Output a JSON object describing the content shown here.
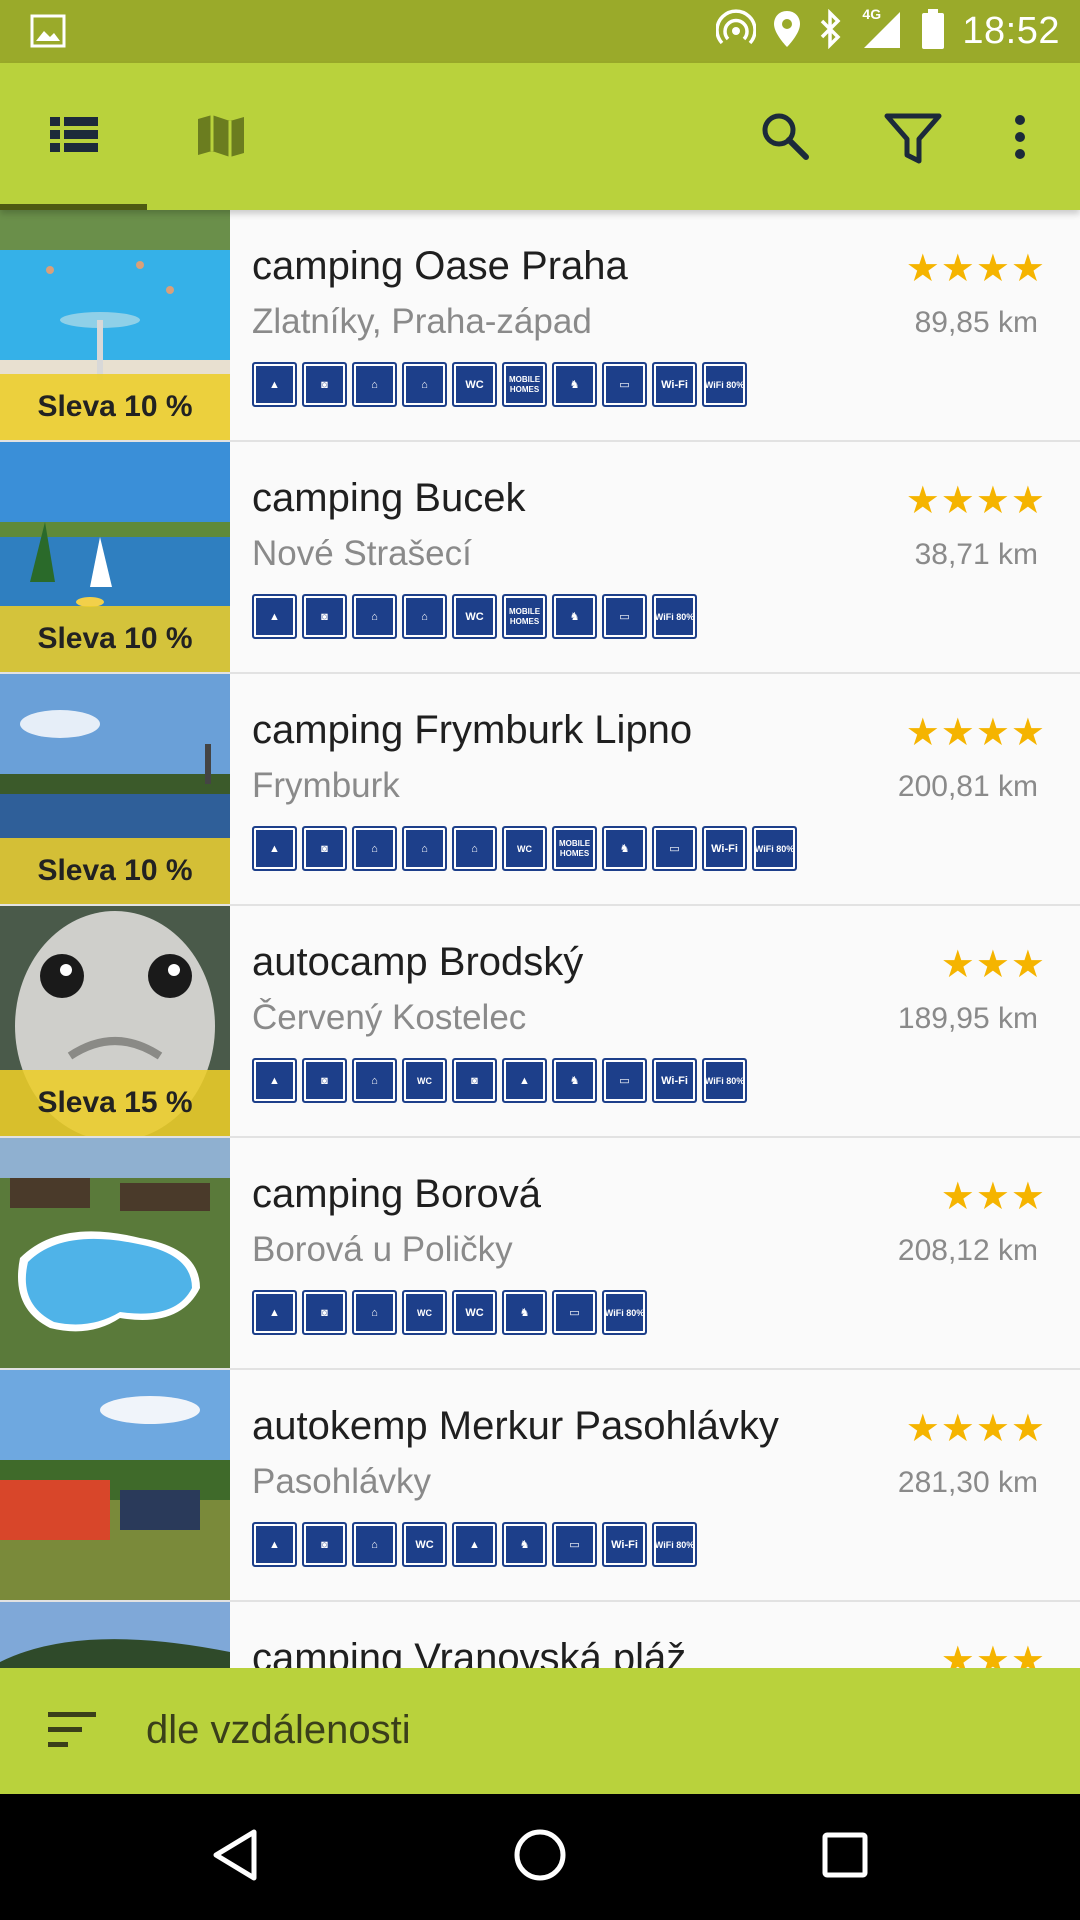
{
  "status_bar": {
    "time": "18:52",
    "network": "4G",
    "icons": [
      "image-icon",
      "hotspot-icon",
      "location-icon",
      "bluetooth-icon",
      "signal-icon",
      "battery-icon"
    ]
  },
  "app_bar": {
    "tabs": [
      {
        "name": "list-view",
        "icon": "list-icon",
        "selected": true
      },
      {
        "name": "map-view",
        "icon": "map-icon",
        "selected": false
      }
    ],
    "actions": [
      "search-icon",
      "filter-icon",
      "more-vert-icon"
    ],
    "colors": {
      "bar": "#b9d23c",
      "status": "#9aaa2a",
      "indicator": "#4e5a12"
    }
  },
  "campsites": [
    {
      "name": "camping Oase Praha",
      "location": "Zlatníky, Praha-západ",
      "stars": "★★★★",
      "distance": "89,85 km",
      "badge": "Sleva 10 %",
      "facilities": [
        "tent",
        "caravan",
        "caravan-in",
        "caravan-out",
        "WC",
        "MOBILE HOMES",
        "horse",
        "laptop",
        "Wi-Fi",
        "WiFi 80%"
      ]
    },
    {
      "name": "camping Bucek",
      "location": "Nové Strašecí",
      "stars": "★★★★",
      "distance": "38,71 km",
      "badge": "Sleva 10 %",
      "facilities": [
        "tent",
        "caravan",
        "caravan-in",
        "caravan-out",
        "WC",
        "MOBILE HOMES",
        "horse",
        "laptop",
        "WiFi 80%"
      ]
    },
    {
      "name": "camping Frymburk Lipno",
      "location": "Frymburk",
      "stars": "★★★★",
      "distance": "200,81 km",
      "badge": "Sleva 10 %",
      "facilities": [
        "tent",
        "caravan",
        "caravan-in",
        "caravan-out",
        "bungalow",
        "bungalow-wc",
        "MOBILE HOMES",
        "horse",
        "laptop",
        "Wi-Fi",
        "WiFi 80%"
      ]
    },
    {
      "name": "autocamp Brodský",
      "location": "Červený Kostelec",
      "stars": "★★★",
      "distance": "189,95 km",
      "badge": "Sleva 15 %",
      "facilities": [
        "tent",
        "caravan",
        "bungalow",
        "bungalow-wc",
        "caravan-2",
        "tent-2",
        "horse",
        "laptop",
        "Wi-Fi",
        "WiFi 80%"
      ]
    },
    {
      "name": "camping Borová",
      "location": "Borová u Poličky",
      "stars": "★★★",
      "distance": "208,12 km",
      "badge": "",
      "facilities": [
        "tent",
        "caravan",
        "bungalow",
        "bungalow-wc",
        "WC",
        "horse",
        "laptop",
        "WiFi 80%"
      ]
    },
    {
      "name": "autokemp Merkur Pasohlávky",
      "location": "Pasohlávky",
      "stars": "★★★★",
      "distance": "281,30 km",
      "badge": "",
      "facilities": [
        "tent",
        "caravan",
        "bungalow",
        "WC",
        "tent-2",
        "horse",
        "laptop",
        "Wi-Fi",
        "WiFi 80%"
      ]
    },
    {
      "name": "camping Vranovská pláž",
      "location": "",
      "stars": "★★★",
      "distance": "",
      "badge": "",
      "facilities": []
    }
  ],
  "sort": {
    "label": "dle vzdálenosti",
    "icon": "sort-icon"
  },
  "nav": [
    "back-icon",
    "home-icon",
    "recents-icon"
  ]
}
